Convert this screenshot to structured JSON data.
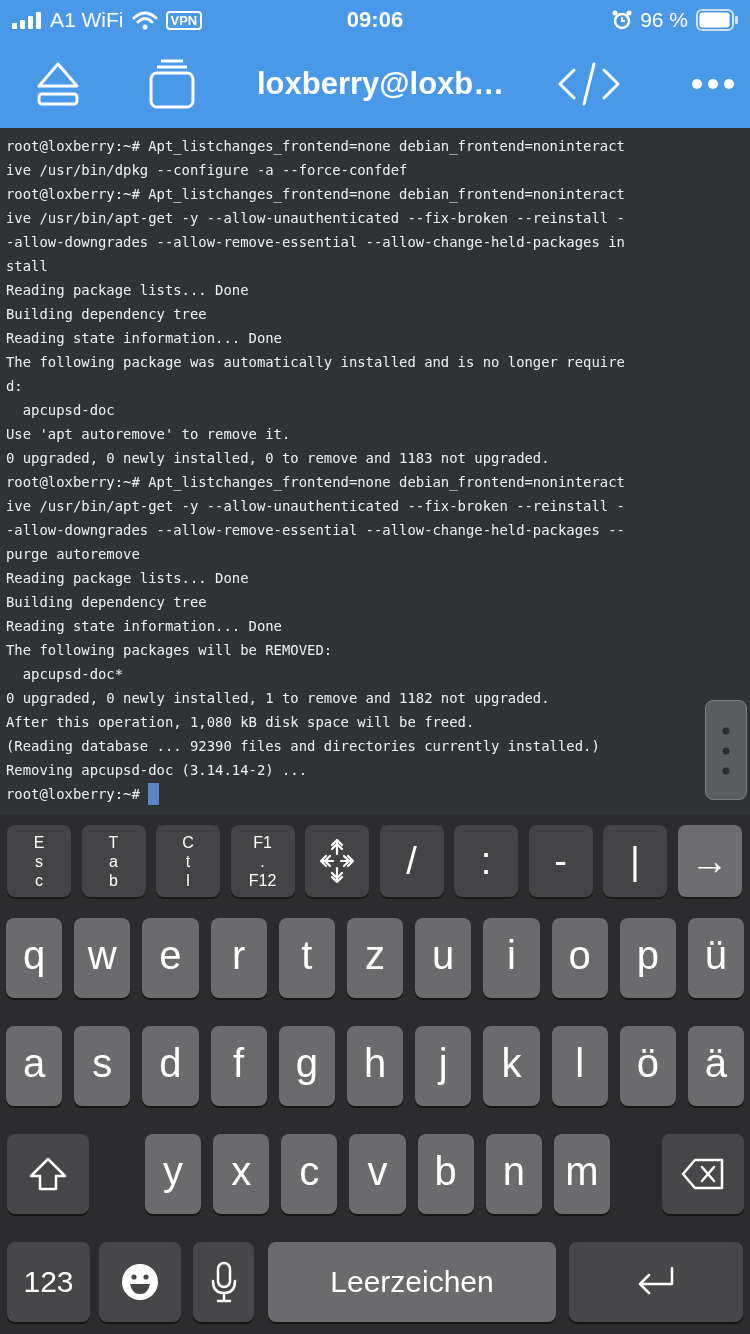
{
  "status_bar": {
    "carrier": "A1 WiFi",
    "vpn": "VPN",
    "time": "09:06",
    "battery": "96 %"
  },
  "header": {
    "title": "loxberry@loxb…"
  },
  "terminal": {
    "cursor_visible": true,
    "rows": [
      "root@loxberry:~# Apt_listchanges_frontend=none debian_frontend=noninteract",
      "ive /usr/bin/dpkg --configure -a --force-confdef",
      "root@loxberry:~# Apt_listchanges_frontend=none debian_frontend=noninteract",
      "ive /usr/bin/apt-get -y --allow-unauthenticated --fix-broken --reinstall -",
      "-allow-downgrades --allow-remove-essential --allow-change-held-packages in",
      "stall",
      "Reading package lists... Done",
      "Building dependency tree",
      "Reading state information... Done",
      "The following package was automatically installed and is no longer require",
      "d:",
      "  apcupsd-doc",
      "Use 'apt autoremove' to remove it.",
      "0 upgraded, 0 newly installed, 0 to remove and 1183 not upgraded.",
      "root@loxberry:~# Apt_listchanges_frontend=none debian_frontend=noninteract",
      "ive /usr/bin/apt-get -y --allow-unauthenticated --fix-broken --reinstall -",
      "-allow-downgrades --allow-remove-essential --allow-change-held-packages --",
      "purge autoremove",
      "Reading package lists... Done",
      "Building dependency tree",
      "Reading state information... Done",
      "The following packages will be REMOVED:",
      "  apcupsd-doc*",
      "0 upgraded, 0 newly installed, 1 to remove and 1182 not upgraded.",
      "After this operation, 1,080 kB disk space will be freed.",
      "(Reading database ... 92390 files and directories currently installed.)",
      "Removing apcupsd-doc (3.14.14-2) ...",
      "root@loxberry:~# "
    ]
  },
  "accessory_keys": [
    {
      "kind": "stack",
      "lines": [
        "E",
        "s",
        "c"
      ]
    },
    {
      "kind": "stack",
      "lines": [
        "T",
        "a",
        "b"
      ]
    },
    {
      "kind": "stack",
      "lines": [
        "C",
        "t",
        "l"
      ]
    },
    {
      "kind": "stack",
      "lines": [
        "F1",
        ".",
        "F12"
      ]
    },
    {
      "kind": "arrows"
    },
    {
      "kind": "char",
      "label": "/"
    },
    {
      "kind": "char",
      "label": ":"
    },
    {
      "kind": "char",
      "label": "-"
    },
    {
      "kind": "char",
      "label": "|"
    },
    {
      "kind": "char",
      "label": "→",
      "highlighted": true
    }
  ],
  "keyboard": {
    "rows": [
      {
        "keys": [
          {
            "kind": "letter",
            "label": "q"
          },
          {
            "kind": "letter",
            "label": "w"
          },
          {
            "kind": "letter",
            "label": "e"
          },
          {
            "kind": "letter",
            "label": "r"
          },
          {
            "kind": "letter",
            "label": "t"
          },
          {
            "kind": "letter",
            "label": "z"
          },
          {
            "kind": "letter",
            "label": "u"
          },
          {
            "kind": "letter",
            "label": "i"
          },
          {
            "kind": "letter",
            "label": "o"
          },
          {
            "kind": "letter",
            "label": "p"
          },
          {
            "kind": "letter",
            "label": "ü"
          }
        ]
      },
      {
        "keys": [
          {
            "kind": "letter",
            "label": "a"
          },
          {
            "kind": "letter",
            "label": "s"
          },
          {
            "kind": "letter",
            "label": "d"
          },
          {
            "kind": "letter",
            "label": "f"
          },
          {
            "kind": "letter",
            "label": "g"
          },
          {
            "kind": "letter",
            "label": "h"
          },
          {
            "kind": "letter",
            "label": "j"
          },
          {
            "kind": "letter",
            "label": "k"
          },
          {
            "kind": "letter",
            "label": "l"
          },
          {
            "kind": "letter",
            "label": "ö"
          },
          {
            "kind": "letter",
            "label": "ä"
          }
        ]
      },
      {
        "keys": [
          {
            "kind": "shift"
          },
          {
            "kind": "letter",
            "label": "y"
          },
          {
            "kind": "letter",
            "label": "x"
          },
          {
            "kind": "letter",
            "label": "c"
          },
          {
            "kind": "letter",
            "label": "v"
          },
          {
            "kind": "letter",
            "label": "b"
          },
          {
            "kind": "letter",
            "label": "n"
          },
          {
            "kind": "letter",
            "label": "m"
          },
          {
            "kind": "backspace"
          }
        ]
      },
      {
        "keys": [
          {
            "kind": "mode",
            "label": "123"
          },
          {
            "kind": "emoji"
          },
          {
            "kind": "mic"
          },
          {
            "kind": "space",
            "label": "Leerzeichen"
          },
          {
            "kind": "return"
          }
        ]
      }
    ]
  }
}
